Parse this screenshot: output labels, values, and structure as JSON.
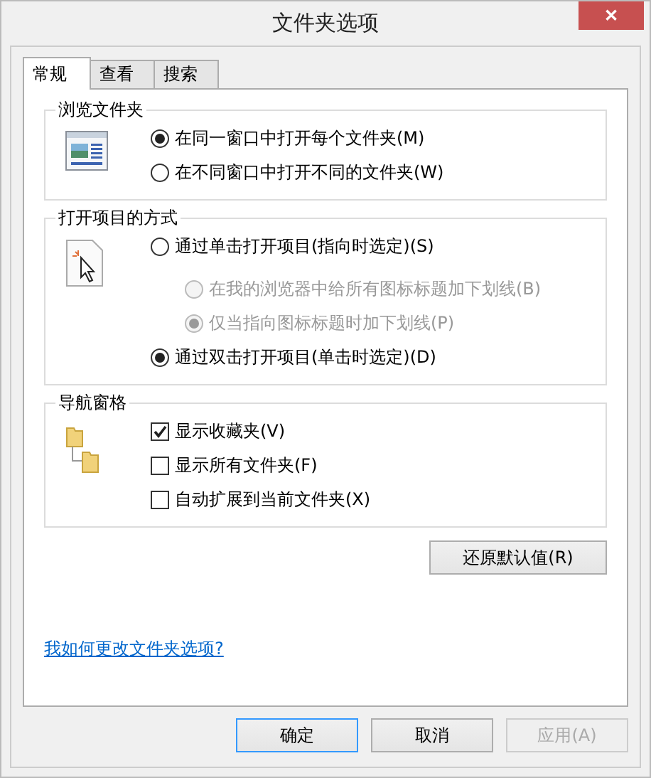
{
  "window": {
    "title": "文件夹选项",
    "close": "✕"
  },
  "tabs": [
    {
      "label": "常规",
      "selected": true
    },
    {
      "label": "查看",
      "selected": false
    },
    {
      "label": "搜索",
      "selected": false
    }
  ],
  "groups": [
    {
      "title": "浏览文件夹",
      "options": [
        {
          "kind": "radio",
          "label": "在同一窗口中打开每个文件夹(M)",
          "selected": true,
          "disabled": false
        },
        {
          "kind": "radio",
          "label": "在不同窗口中打开不同的文件夹(W)",
          "selected": false,
          "disabled": false
        }
      ]
    },
    {
      "title": "打开项目的方式",
      "options": [
        {
          "kind": "radio",
          "label": "通过单击打开项目(指向时选定)(S)",
          "selected": false,
          "disabled": false,
          "children": [
            {
              "kind": "radio",
              "label": "在我的浏览器中给所有图标标题加下划线(B)",
              "selected": false,
              "disabled": true
            },
            {
              "kind": "radio",
              "label": "仅当指向图标标题时加下划线(P)",
              "selected": true,
              "disabled": true
            }
          ]
        },
        {
          "kind": "radio",
          "label": "通过双击打开项目(单击时选定)(D)",
          "selected": true,
          "disabled": false
        }
      ]
    },
    {
      "title": "导航窗格",
      "options": [
        {
          "kind": "checkbox",
          "label": "显示收藏夹(V)",
          "checked": true,
          "disabled": false
        },
        {
          "kind": "checkbox",
          "label": "显示所有文件夹(F)",
          "checked": false,
          "disabled": false
        },
        {
          "kind": "checkbox",
          "label": "自动扩展到当前文件夹(X)",
          "checked": false,
          "disabled": false
        }
      ]
    }
  ],
  "restore_button": "还原默认值(R)",
  "help_link": "我如何更改文件夹选项?",
  "buttons": [
    {
      "label": "确定",
      "default": true,
      "disabled": false
    },
    {
      "label": "取消",
      "default": false,
      "disabled": false
    },
    {
      "label": "应用(A)",
      "default": false,
      "disabled": true
    }
  ]
}
